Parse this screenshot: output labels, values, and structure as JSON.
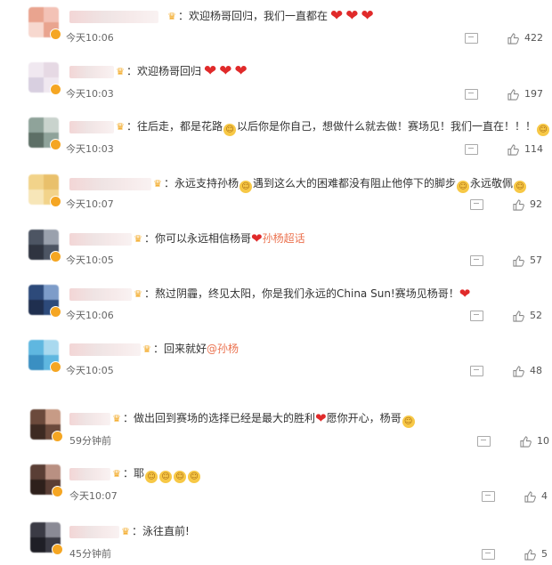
{
  "comments": [
    {
      "text_parts": [
        {
          "t": "：欢迎杨哥回归，我们一直都在"
        }
      ],
      "hearts": 3,
      "time": "今天10:06",
      "likes": "422"
    },
    {
      "text_parts": [
        {
          "t": "：欢迎杨哥回归"
        }
      ],
      "hearts": 3,
      "time": "今天10:03",
      "likes": "197"
    },
    {
      "text_parts": [
        {
          "t": "：往后走，都是花路"
        },
        {
          "emo": "😍"
        },
        {
          "t": "以后你是你自己，想做什么就去做！赛场见！我们一直在！！！"
        },
        {
          "emo": "😍"
        }
      ],
      "hearts": 0,
      "time": "今天10:03",
      "likes": "114"
    },
    {
      "text_parts": [
        {
          "t": "：永远支持孙杨"
        },
        {
          "emo": "😱"
        },
        {
          "t": "遇到这么大的困难都没有阻止他停下的脚步"
        },
        {
          "emo": "😭"
        },
        {
          "t": "永远敬佩"
        },
        {
          "emo": "🙏"
        }
      ],
      "hearts": 0,
      "time": "今天10:07",
      "likes": "92"
    },
    {
      "text_parts": [
        {
          "t": "：你可以永远相信杨哥"
        },
        {
          "heart": true
        },
        {
          "at": "孙杨超话"
        }
      ],
      "hearts": 0,
      "time": "今天10:05",
      "likes": "57"
    },
    {
      "text_parts": [
        {
          "t": "：熬过阴霾，终见太阳，你是我们永远的China Sun!赛场见杨哥！"
        },
        {
          "heart": true
        }
      ],
      "hearts": 0,
      "time": "今天10:06",
      "likes": "52"
    },
    {
      "text_parts": [
        {
          "t": "：回来就好"
        },
        {
          "at": "@孙杨"
        }
      ],
      "hearts": 0,
      "time": "今天10:05",
      "likes": "48"
    },
    {
      "text_parts": [
        {
          "t": "：做出回到赛场的选择已经是最大的胜利"
        },
        {
          "heart": true
        },
        {
          "t": "愿你开心，杨哥"
        },
        {
          "emo": "😱"
        }
      ],
      "hearts": 0,
      "time": "59分钟前",
      "likes": "10"
    },
    {
      "text_parts": [
        {
          "t": "：耶"
        },
        {
          "emo": "🥳"
        },
        {
          "emo": "🥳"
        },
        {
          "emo": "🥳"
        },
        {
          "emo": "🥳"
        }
      ],
      "hearts": 0,
      "time": "今天10:07",
      "likes": "4"
    },
    {
      "text_parts": [
        {
          "t": "：泳往直前!"
        }
      ],
      "hearts": 0,
      "time": "45分钟前",
      "likes": "5"
    }
  ],
  "icons": {
    "comment": "comment-icon",
    "like": "thumbs-up-icon",
    "vip": "crown-icon"
  }
}
